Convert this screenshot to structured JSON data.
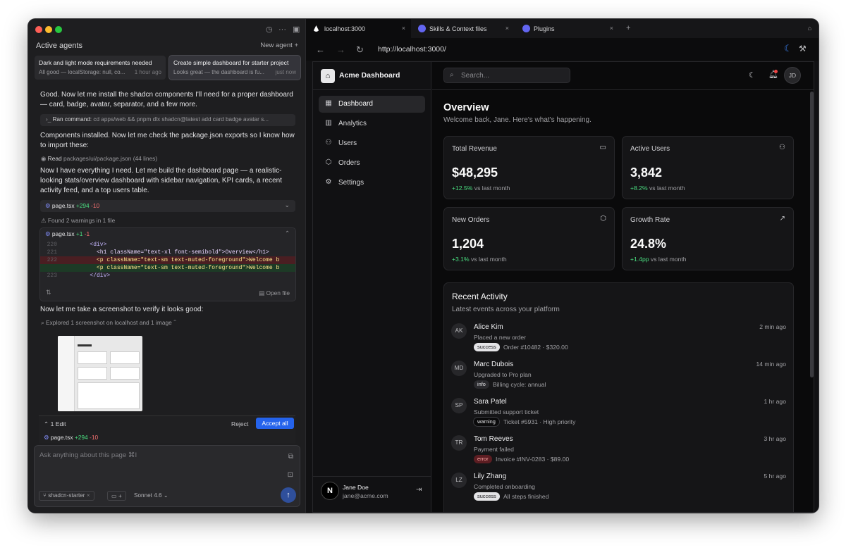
{
  "left": {
    "active_agents_title": "Active agents",
    "new_agent_label": "New agent",
    "agents": [
      {
        "title": "Dark and light mode requirements needed",
        "subtitle": "All good — localStorage: null, co...",
        "time": "1 hour ago"
      },
      {
        "title": "Create simple dashboard for starter project",
        "subtitle": "Looks great — the dashboard is fu...",
        "time": "just now"
      }
    ],
    "msg1": "Good. Now let me install the shadcn components I'll need for a proper dashboard — card, badge, avatar, separator, and a few more.",
    "cmd_label": "Ran command:",
    "cmd_text": "cd apps/web && pnpm dlx shadcn@latest add card badge avatar s...",
    "msg2": "Components installed. Now let me check the package.json exports so I know how to import these:",
    "read_label": "Read",
    "read_file": "packages/ui/package.json (44 lines)",
    "msg3": "Now I have everything I need. Let me build the dashboard page — a realistic-looking stats/overview dashboard with sidebar navigation, KPI cards, a recent activity feed, and a top users table.",
    "file1": {
      "name": "page.tsx",
      "add": "+294",
      "del": "-10"
    },
    "warnings": "Found 2 warnings in 1 file",
    "file2": {
      "name": "page.tsx",
      "add": "+1",
      "del": "-1"
    },
    "diff_lines": [
      {
        "n": "220",
        "code": "        <div>",
        "kind": "ctx"
      },
      {
        "n": "221",
        "code": "          <h1 className=\"text-xl font-semibold\">Overview</h1>",
        "kind": "ctx"
      },
      {
        "n": "222",
        "code": "          <p className=\"text-sm text-muted-foreground\">Welcome b",
        "kind": "rem"
      },
      {
        "n": "",
        "code": "          <p className=\"text-sm text-muted-foreground\">Welcome b",
        "kind": "add"
      },
      {
        "n": "223",
        "code": "        </div>",
        "kind": "ctx"
      }
    ],
    "open_file": "Open file",
    "msg4": "Now let me take a screenshot to verify it looks good:",
    "explored": "Explored 1 screenshot on localhost and 1 image",
    "edit_count": "1 Edit",
    "reject": "Reject",
    "accept_all": "Accept all",
    "edit_file": {
      "name": "page.tsx",
      "add": "+294",
      "del": "-10"
    },
    "composer_placeholder": "Ask anything about this page ⌘I",
    "branch": "shadcn-starter",
    "model": "Sonnet 4.6"
  },
  "browser": {
    "tabs": [
      "localhost:3000",
      "Skills & Context files",
      "Plugins"
    ],
    "url": "http://localhost:3000/"
  },
  "app": {
    "brand": "Acme Dashboard",
    "nav": [
      "Dashboard",
      "Analytics",
      "Users",
      "Orders",
      "Settings"
    ],
    "search_placeholder": "Search...",
    "user_initials": "JD",
    "user_name": "Jane Doe",
    "user_email": "jane@acme.com",
    "page_title": "Overview",
    "page_subtitle": "Welcome back, Jane. Here's what's happening.",
    "kpis": [
      {
        "label": "Total Revenue",
        "value": "$48,295",
        "change": "+12.5%",
        "suffix": "vs last month"
      },
      {
        "label": "Active Users",
        "value": "3,842",
        "change": "+8.2%",
        "suffix": "vs last month"
      },
      {
        "label": "New Orders",
        "value": "1,204",
        "change": "+3.1%",
        "suffix": "vs last month"
      },
      {
        "label": "Growth Rate",
        "value": "24.8%",
        "change": "+1.4pp",
        "suffix": "vs last month"
      }
    ],
    "activity_title": "Recent Activity",
    "activity_subtitle": "Latest events across your platform",
    "activity": [
      {
        "initials": "AK",
        "name": "Alice Kim",
        "desc": "Placed a new order",
        "badge": "success",
        "meta": "Order #10482 · $320.00",
        "time": "2 min ago"
      },
      {
        "initials": "MD",
        "name": "Marc Dubois",
        "desc": "Upgraded to Pro plan",
        "badge": "info",
        "meta": "Billing cycle: annual",
        "time": "14 min ago"
      },
      {
        "initials": "SP",
        "name": "Sara Patel",
        "desc": "Submitted support ticket",
        "badge": "warning",
        "meta": "Ticket #5931 · High priority",
        "time": "1 hr ago"
      },
      {
        "initials": "TR",
        "name": "Tom Reeves",
        "desc": "Payment failed",
        "badge": "error",
        "meta": "Invoice #INV-0283 · $89.00",
        "time": "3 hr ago"
      },
      {
        "initials": "LZ",
        "name": "Lily Zhang",
        "desc": "Completed onboarding",
        "badge": "success",
        "meta": "All steps finished",
        "time": "5 hr ago"
      }
    ]
  },
  "colors": {
    "accent": "#2563eb",
    "positive": "#4ade80",
    "negative": "#f87171"
  }
}
